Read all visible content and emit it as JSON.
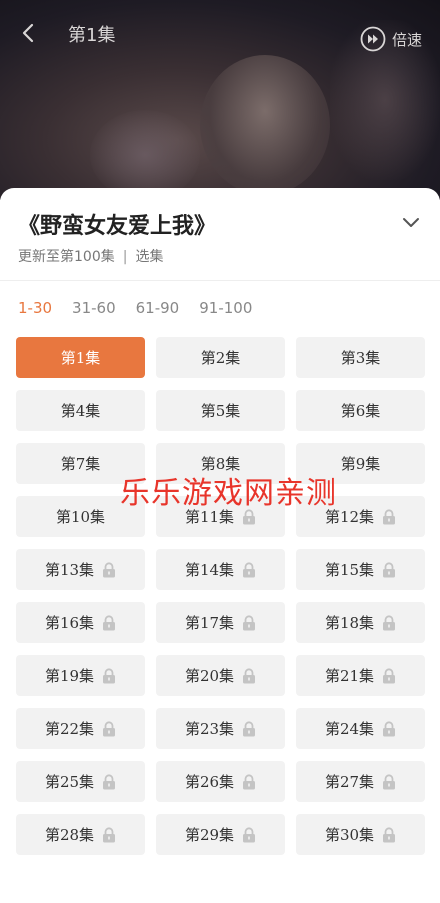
{
  "header": {
    "episode_title": "第1集",
    "speed_label": "倍速"
  },
  "sheet": {
    "title": "《野蛮女友爱上我》",
    "update_status": "更新至第100集",
    "separator": "|",
    "select_label": "选集",
    "ranges": [
      {
        "label": "1-30",
        "active": true
      },
      {
        "label": "31-60",
        "active": false
      },
      {
        "label": "61-90",
        "active": false
      },
      {
        "label": "91-100",
        "active": false
      }
    ],
    "episodes": [
      {
        "label": "第1集",
        "active": true,
        "locked": false
      },
      {
        "label": "第2集",
        "active": false,
        "locked": false
      },
      {
        "label": "第3集",
        "active": false,
        "locked": false
      },
      {
        "label": "第4集",
        "active": false,
        "locked": false
      },
      {
        "label": "第5集",
        "active": false,
        "locked": false
      },
      {
        "label": "第6集",
        "active": false,
        "locked": false
      },
      {
        "label": "第7集",
        "active": false,
        "locked": false
      },
      {
        "label": "第8集",
        "active": false,
        "locked": false
      },
      {
        "label": "第9集",
        "active": false,
        "locked": false
      },
      {
        "label": "第10集",
        "active": false,
        "locked": false
      },
      {
        "label": "第11集",
        "active": false,
        "locked": true
      },
      {
        "label": "第12集",
        "active": false,
        "locked": true
      },
      {
        "label": "第13集",
        "active": false,
        "locked": true
      },
      {
        "label": "第14集",
        "active": false,
        "locked": true
      },
      {
        "label": "第15集",
        "active": false,
        "locked": true
      },
      {
        "label": "第16集",
        "active": false,
        "locked": true
      },
      {
        "label": "第17集",
        "active": false,
        "locked": true
      },
      {
        "label": "第18集",
        "active": false,
        "locked": true
      },
      {
        "label": "第19集",
        "active": false,
        "locked": true
      },
      {
        "label": "第20集",
        "active": false,
        "locked": true
      },
      {
        "label": "第21集",
        "active": false,
        "locked": true
      },
      {
        "label": "第22集",
        "active": false,
        "locked": true
      },
      {
        "label": "第23集",
        "active": false,
        "locked": true
      },
      {
        "label": "第24集",
        "active": false,
        "locked": true
      },
      {
        "label": "第25集",
        "active": false,
        "locked": true
      },
      {
        "label": "第26集",
        "active": false,
        "locked": true
      },
      {
        "label": "第27集",
        "active": false,
        "locked": true
      },
      {
        "label": "第28集",
        "active": false,
        "locked": true
      },
      {
        "label": "第29集",
        "active": false,
        "locked": true
      },
      {
        "label": "第30集",
        "active": false,
        "locked": true
      }
    ]
  },
  "watermark": "乐乐游戏网亲测",
  "icons": {
    "back": "back-arrow-icon",
    "speed": "fast-forward-icon",
    "collapse": "chevron-down-icon",
    "lock": "lock-icon"
  },
  "colors": {
    "accent": "#e8773f",
    "watermark": "#e8352b"
  }
}
